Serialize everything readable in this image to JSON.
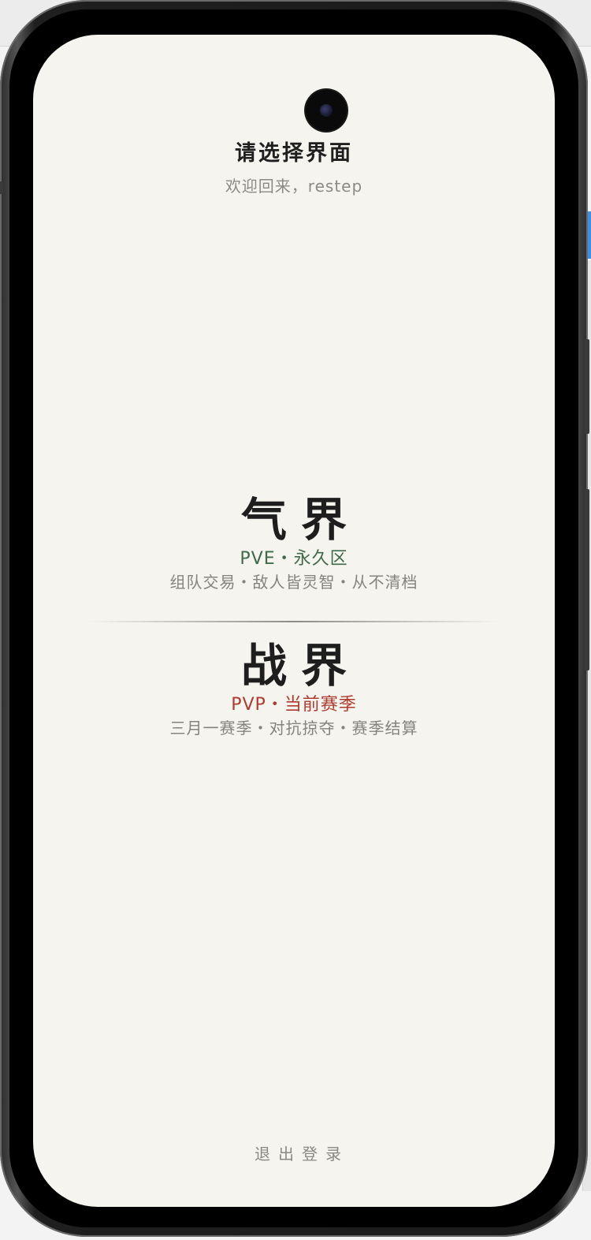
{
  "header": {
    "title": "请选择界面",
    "welcome": "欢迎回来，restep"
  },
  "realms": [
    {
      "name": "气界",
      "tag": "PVE・永久区",
      "description": "组队交易・敌人皆灵智・从不清档",
      "accent_color": "#3f6a4a"
    },
    {
      "name": "战界",
      "tag": "PVP・当前赛季",
      "description": "三月一赛季・对抗掠夺・赛季结算",
      "accent_color": "#b03a2e"
    }
  ],
  "footer": {
    "logout_label": "退出登录"
  },
  "colors": {
    "screen_background": "#f5f4ef",
    "title_text": "#1f1f1f",
    "muted_text": "#8a8a86"
  }
}
